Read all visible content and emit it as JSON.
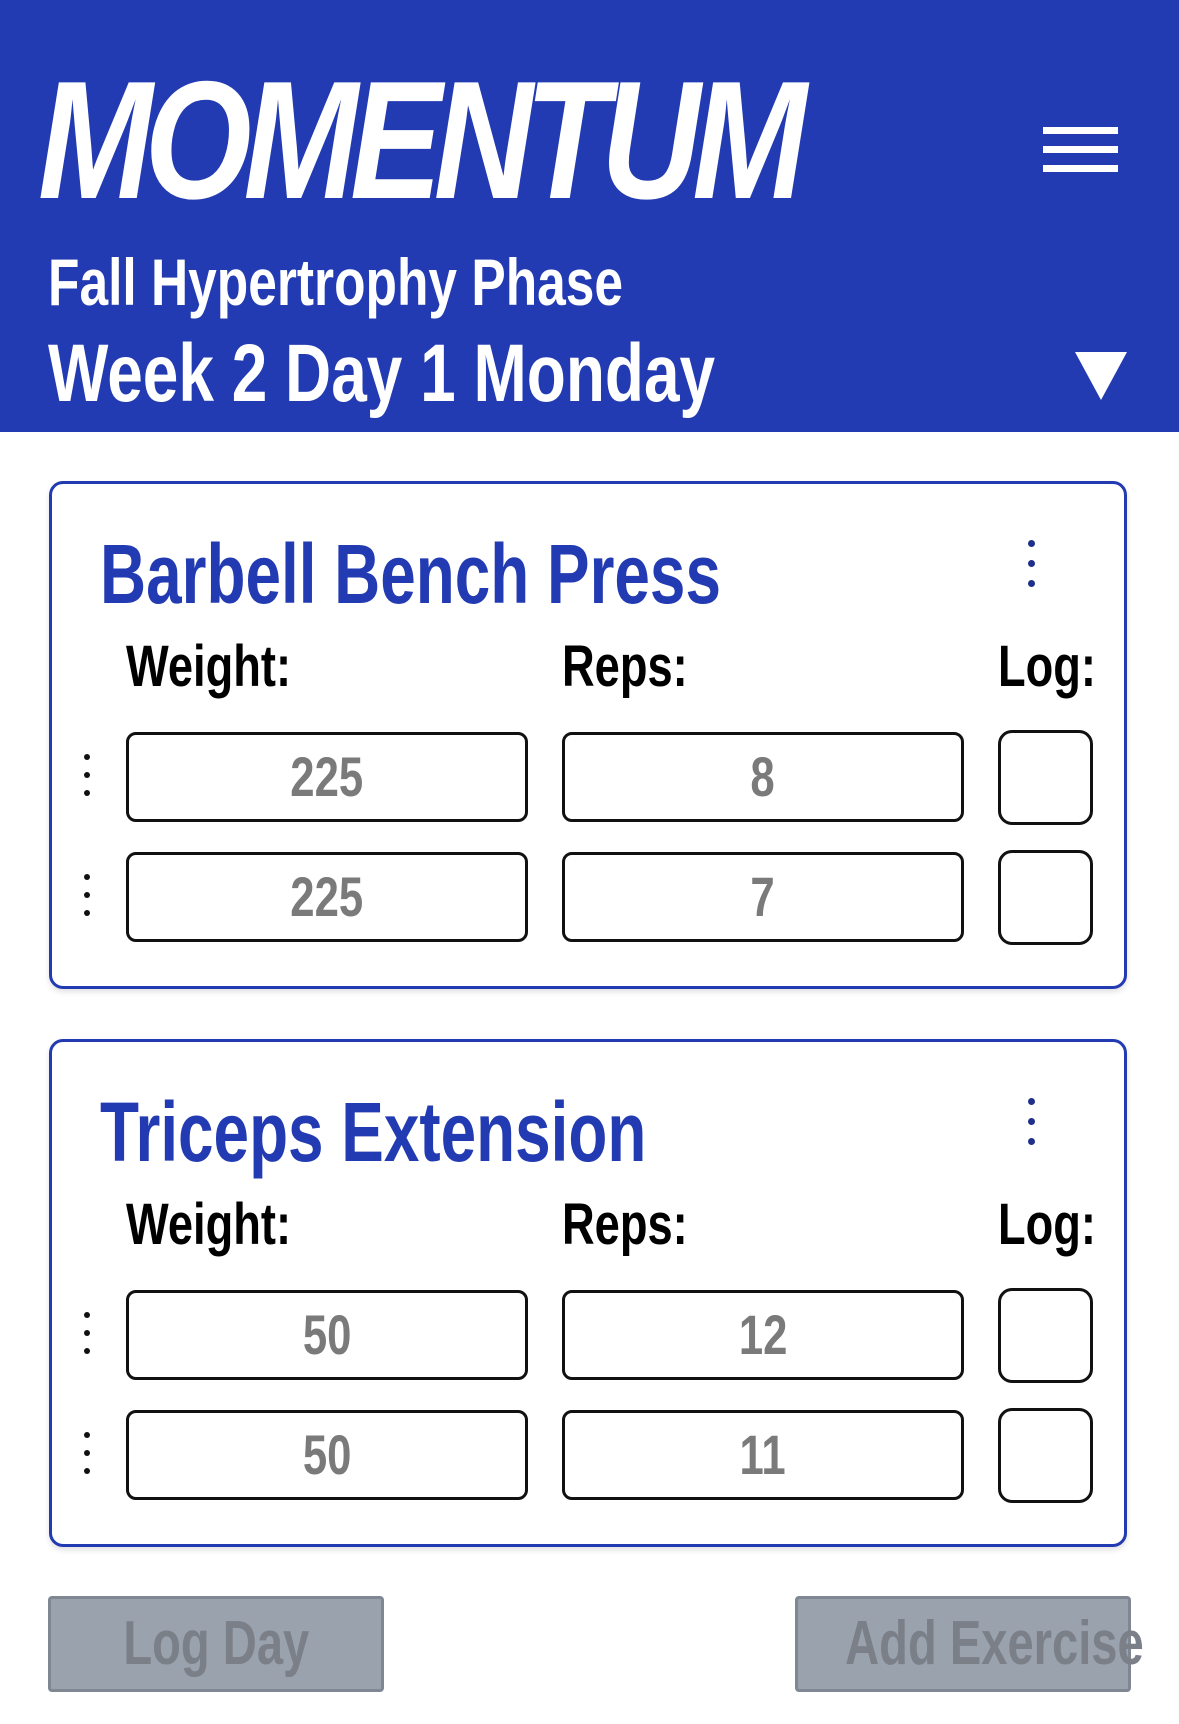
{
  "header": {
    "brand": "MOMENTUM",
    "phase": "Fall Hypertrophy Phase",
    "day": "Week 2 Day 1 Monday"
  },
  "icons": {
    "menu": "hamburger-menu-icon",
    "day_toggle": "triangle-down-icon",
    "kebab": "vertical-ellipsis-icon"
  },
  "colors": {
    "brand_blue": "#233bb2",
    "button_disabled": "#9aa2ae"
  },
  "exercises": [
    {
      "name": "Barbell Bench Press",
      "labels": {
        "weight": "Weight:",
        "reps": "Reps:",
        "log": "Log:"
      },
      "sets": [
        {
          "weight": "225",
          "reps": "8",
          "logged": false
        },
        {
          "weight": "225",
          "reps": "7",
          "logged": false
        }
      ]
    },
    {
      "name": "Triceps Extension",
      "labels": {
        "weight": "Weight:",
        "reps": "Reps:",
        "log": "Log:"
      },
      "sets": [
        {
          "weight": "50",
          "reps": "12",
          "logged": false
        },
        {
          "weight": "50",
          "reps": "11",
          "logged": false
        }
      ]
    }
  ],
  "actions": {
    "log_day": "Log Day",
    "add_exercise": "Add Exercise"
  }
}
